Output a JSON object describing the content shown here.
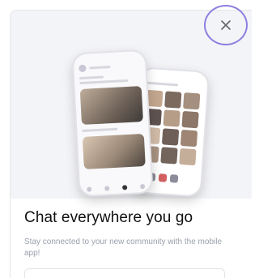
{
  "modal": {
    "close_glyph": "×",
    "title": "Chat everywhere you go",
    "subtitle": "Stay connected to your new community with the mobile app!"
  },
  "colors": {
    "close_ring": "#8b7fe0",
    "title_text": "#111111",
    "subtitle_text": "#9aa0ad",
    "hero_bg": "#f3f4f7"
  },
  "icons": {
    "close": "close-icon"
  }
}
